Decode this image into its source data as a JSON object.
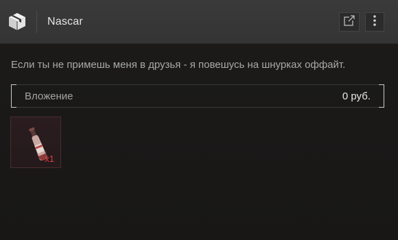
{
  "header": {
    "title": "Nascar",
    "logo_icon": "box-logo-icon",
    "open_icon": "external-link-icon",
    "more_icon": "vertical-dots-icon"
  },
  "message": "Если ты не примешь меня в друзья - я повешусь на шнурках оффайт.",
  "attachment": {
    "label": "Вложение",
    "value": "0 руб."
  },
  "items": [
    {
      "icon": "bottle-icon",
      "quantity": "x1",
      "accent_color": "#e33a3a"
    }
  ]
}
